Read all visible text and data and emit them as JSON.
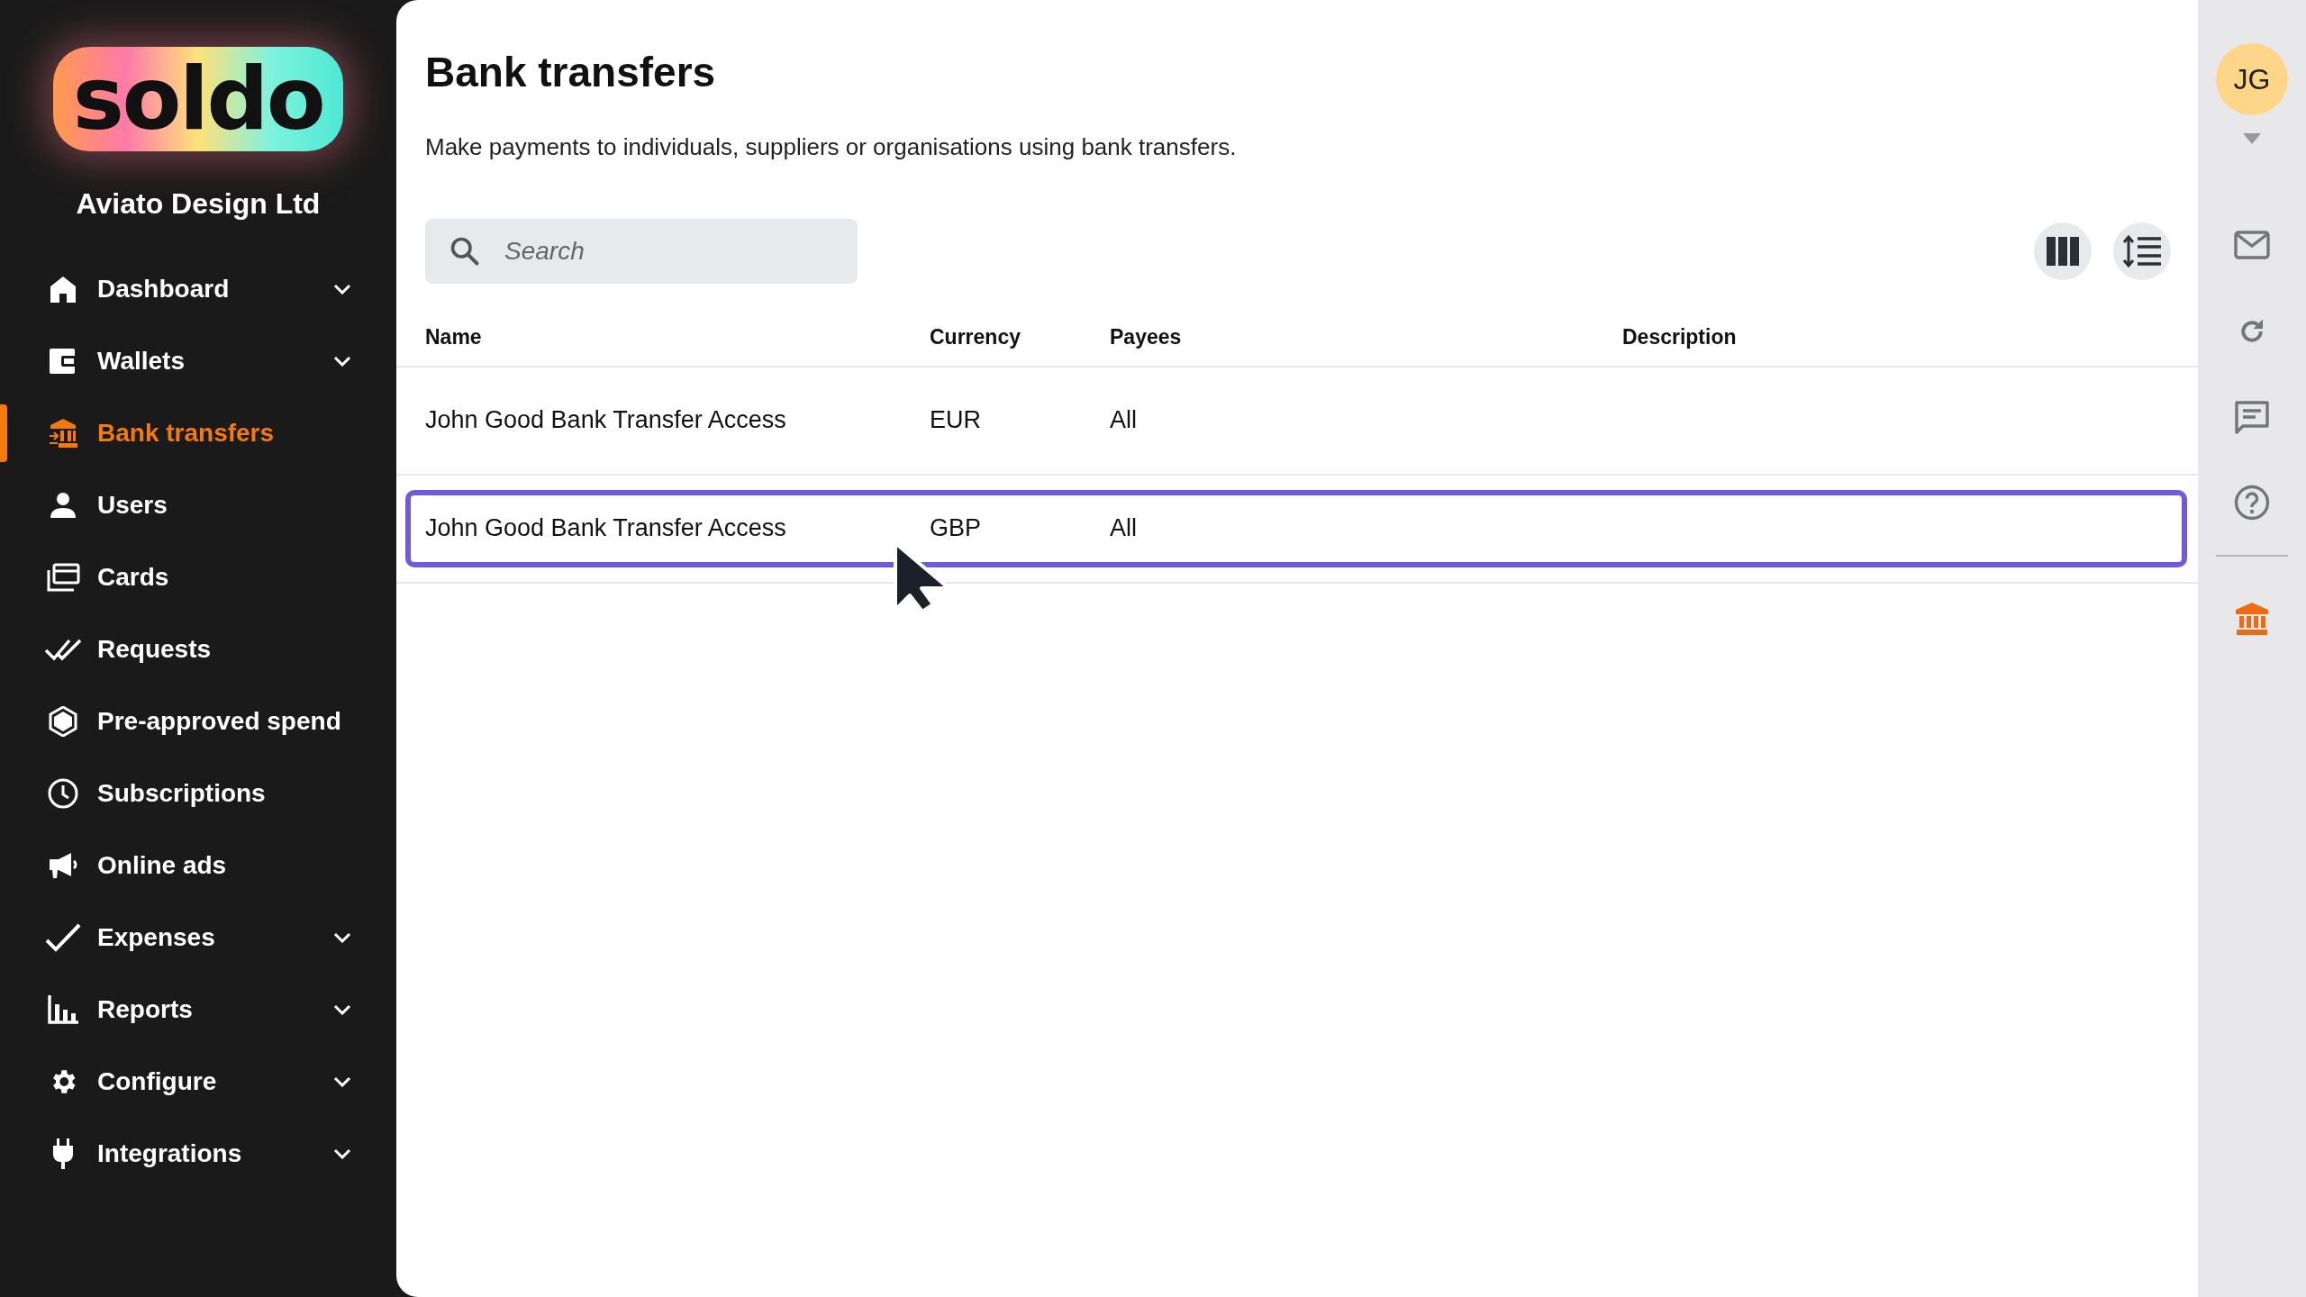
{
  "sidebar": {
    "logo": "soldo",
    "company": "Aviato Design Ltd",
    "items": [
      {
        "label": "Dashboard",
        "selected": false,
        "expandable": true
      },
      {
        "label": "Wallets",
        "selected": false,
        "expandable": true
      },
      {
        "label": "Bank transfers",
        "selected": true,
        "expandable": false
      },
      {
        "label": "Users",
        "selected": false,
        "expandable": false
      },
      {
        "label": "Cards",
        "selected": false,
        "expandable": false
      },
      {
        "label": "Requests",
        "selected": false,
        "expandable": false
      },
      {
        "label": "Pre-approved spend",
        "selected": false,
        "expandable": false
      },
      {
        "label": "Subscriptions",
        "selected": false,
        "expandable": false
      },
      {
        "label": "Online ads",
        "selected": false,
        "expandable": false
      },
      {
        "label": "Expenses",
        "selected": false,
        "expandable": true
      },
      {
        "label": "Reports",
        "selected": false,
        "expandable": true
      },
      {
        "label": "Configure",
        "selected": false,
        "expandable": true
      },
      {
        "label": "Integrations",
        "selected": false,
        "expandable": true
      }
    ]
  },
  "page": {
    "title": "Bank transfers",
    "description": "Make payments to individuals, suppliers or organisations using bank transfers."
  },
  "search": {
    "placeholder": "Search"
  },
  "table": {
    "columns": [
      "Name",
      "Currency",
      "Payees",
      "Description"
    ],
    "rows": [
      {
        "cells": [
          "John Good Bank Transfer Access",
          "EUR",
          "All"
        ],
        "selected": false
      },
      {
        "cells": [
          "John Good Bank Transfer Access",
          "GBP",
          "All"
        ],
        "selected": true
      }
    ]
  },
  "user": {
    "initials": "JG"
  }
}
